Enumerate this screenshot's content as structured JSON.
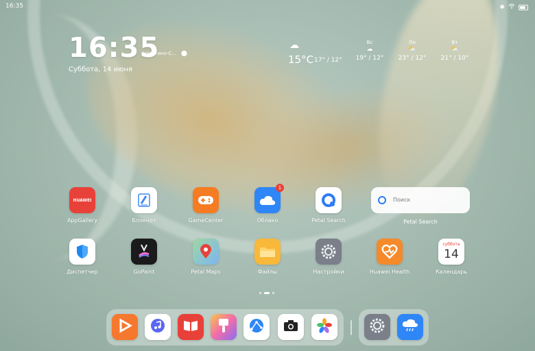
{
  "status_bar": {
    "time": "16:35",
    "icons": [
      "bluetooth-icon",
      "wifi-icon",
      "battery-icon"
    ]
  },
  "clock_widget": {
    "time": "16:35",
    "location": "Нагатино-С...",
    "date": "Суббота, 14 июня"
  },
  "weather_widget": {
    "current": {
      "icon": "cloud-rain-icon",
      "temp": "15°C",
      "range": "17° / 12°"
    },
    "forecast": [
      {
        "day": "Вс",
        "icon": "cloud-rain-icon",
        "range": "19° / 12°"
      },
      {
        "day": "Пн",
        "icon": "sun-cloud-icon",
        "range": "23° / 12°"
      },
      {
        "day": "Вт",
        "icon": "sun-cloud-icon",
        "range": "21° / 10°"
      }
    ]
  },
  "apps_row1": [
    {
      "label": "AppGallery",
      "icon": "appgallery-icon",
      "color": "#e8413a",
      "text": "HUAWEI"
    },
    {
      "label": "Блокнот",
      "icon": "notepad-icon",
      "color": "#ffffff"
    },
    {
      "label": "GameCenter",
      "icon": "gamepad-icon",
      "color": "#f57c23"
    },
    {
      "label": "Облако",
      "icon": "cloud-icon",
      "color": "#2f86f6",
      "badge": "1"
    },
    {
      "label": "Petal Search",
      "icon": "petal-search-icon",
      "color": "#ffffff"
    }
  ],
  "search_widget": {
    "placeholder": "Поиск",
    "label": "Petal Search"
  },
  "apps_row2": [
    {
      "label": "Диспетчер",
      "icon": "shield-icon",
      "color": "#ffffff"
    },
    {
      "label": "GoPaint",
      "icon": "gopaint-icon",
      "color": "#1b1b1b"
    },
    {
      "label": "Petal Maps",
      "icon": "map-pin-icon",
      "color": "#ffffff"
    },
    {
      "label": "Файлы",
      "icon": "folder-icon",
      "color": "#f8b83a"
    },
    {
      "label": "Настройки",
      "icon": "gear-icon",
      "color": "#7a7f8a"
    },
    {
      "label": "Huawei Health",
      "icon": "heart-icon",
      "color": "#f58a2a"
    },
    {
      "label": "Календарь",
      "icon": "calendar-icon",
      "color": "#ffffff",
      "weekday": "суббота",
      "day": "14"
    }
  ],
  "dock": [
    {
      "name": "video-app",
      "icon": "play-icon",
      "color": "#f5782e"
    },
    {
      "name": "music-app",
      "icon": "music-note-icon",
      "color": "#ffffff"
    },
    {
      "name": "books-app",
      "icon": "book-icon",
      "color": "#e8413a"
    },
    {
      "name": "themes-app",
      "icon": "brush-icon",
      "color": "#a96cf0"
    },
    {
      "name": "browser-app",
      "icon": "globe-icon",
      "color": "#ffffff"
    },
    {
      "name": "camera-app",
      "icon": "camera-icon",
      "color": "#ffffff"
    },
    {
      "name": "gallery-app",
      "icon": "flower-icon",
      "color": "#ffffff"
    }
  ],
  "dock_recent": [
    {
      "name": "settings-app",
      "icon": "gear-icon",
      "color": "#7a7f8a"
    },
    {
      "name": "weather-app",
      "icon": "cloud-rain-icon",
      "color": "#2f86f6"
    }
  ],
  "page_indicator": {
    "pages": 3,
    "active": 1
  }
}
